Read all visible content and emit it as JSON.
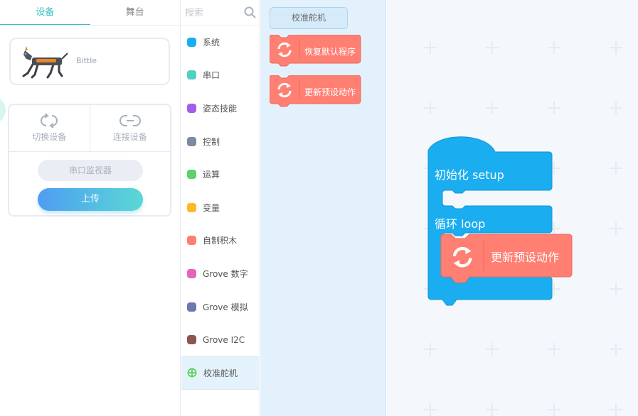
{
  "left_panel": {
    "tabs": [
      {
        "label": "设备",
        "active": true
      },
      {
        "label": "舞台",
        "active": false
      }
    ],
    "device": {
      "name": "Bittle"
    },
    "actions": {
      "switch_device": "切换设备",
      "connect_device": "连接设备",
      "serial_monitor": "串口监视器",
      "upload": "上传"
    }
  },
  "categories": {
    "search_placeholder": "搜索",
    "items": [
      {
        "label": "系统",
        "color": "#1aadf0"
      },
      {
        "label": "串口",
        "color": "#4ed1c2"
      },
      {
        "label": "姿态技能",
        "color": "#a45ee5"
      },
      {
        "label": "控制",
        "color": "#7b8ba4"
      },
      {
        "label": "运算",
        "color": "#5dd16b"
      },
      {
        "label": "变量",
        "color": "#fbb92a"
      },
      {
        "label": "自制积木",
        "color": "#ff7f72"
      },
      {
        "label": "Grove 数字",
        "color": "#e466b5"
      },
      {
        "label": "Grove 模拟",
        "color": "#6c78ae"
      },
      {
        "label": "Grove I2C",
        "color": "#8b5552"
      },
      {
        "label": "校准舵机",
        "color": "#5bd25b",
        "icon": "crosshair-icon",
        "active": true
      }
    ]
  },
  "flyout": {
    "label": "校准舵机",
    "blocks": [
      {
        "text": "恢复默认程序",
        "icon": "refresh-icon"
      },
      {
        "text": "更新预设动作",
        "icon": "refresh-icon"
      }
    ]
  },
  "workspace": {
    "setup_label": "初始化 setup",
    "loop_label": "循环 loop",
    "inner_block": {
      "text": "更新预设动作",
      "icon": "refresh-icon"
    }
  },
  "colors": {
    "accent": "#39c0c0",
    "hat_block": "#1aadf0",
    "custom_block": "#ff7f72"
  }
}
